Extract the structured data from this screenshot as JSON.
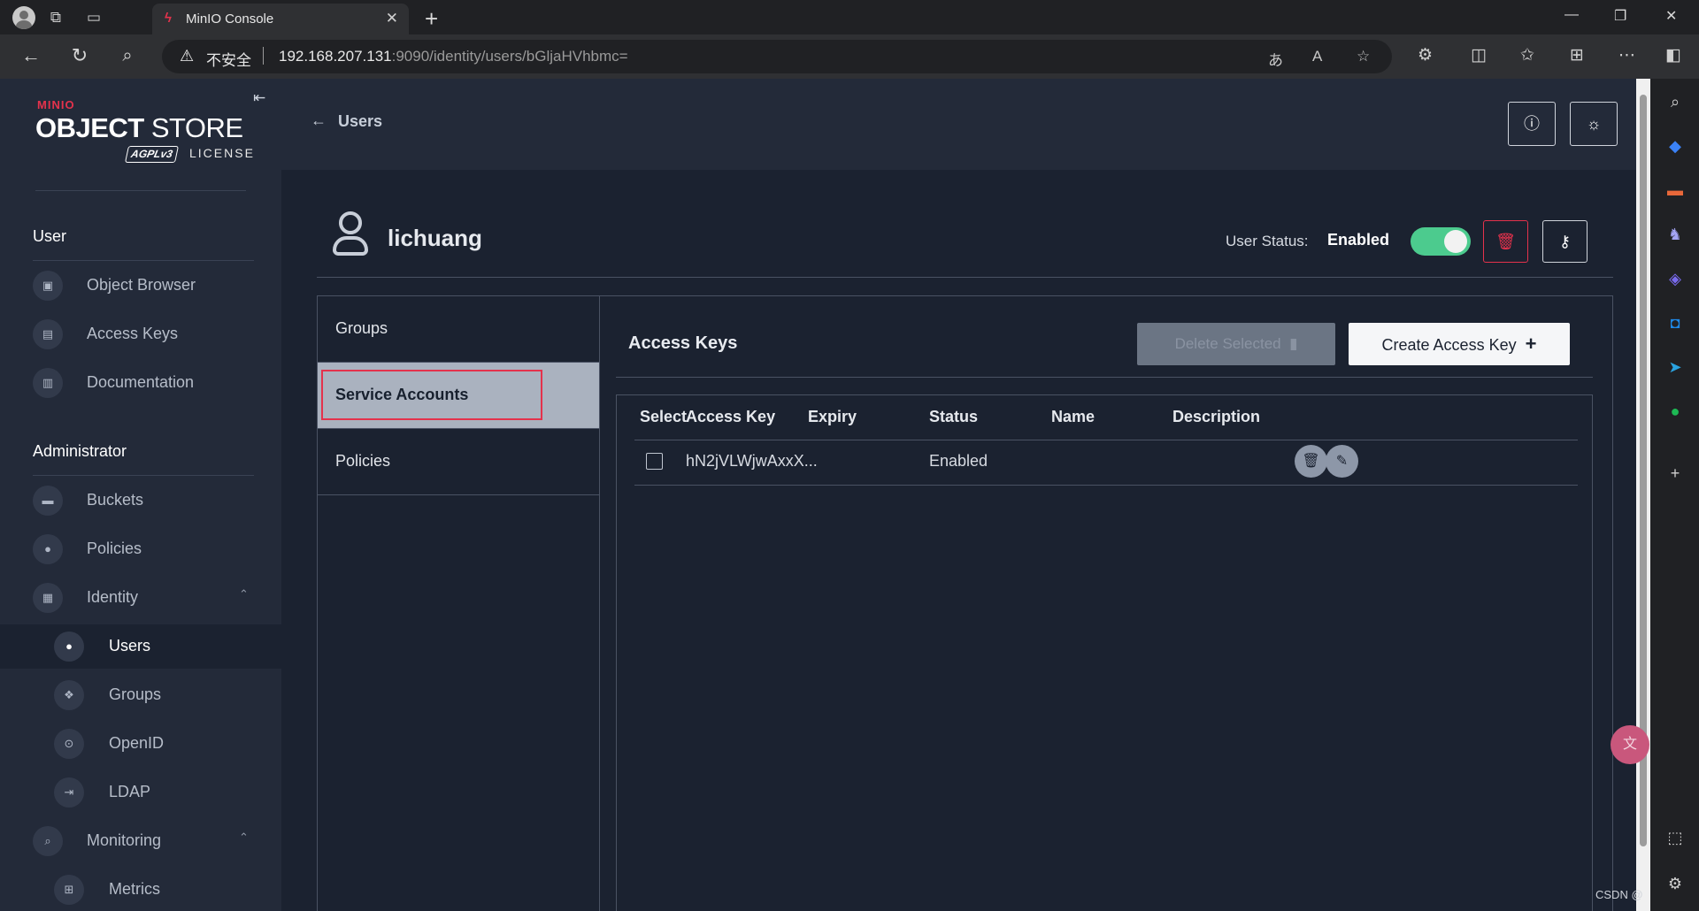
{
  "browser": {
    "tab_title": "MinIO Console",
    "tab_favicon": "minio-favicon",
    "security_warning": "不安全",
    "url_host": "192.168.207.131",
    "url_rest": ":9090/identity/users/bGljaHVhbmc=",
    "icons": [
      "profile-avatar",
      "workspaces-icon",
      "tab-actions-icon",
      "close-icon",
      "new-tab-icon",
      "back-icon",
      "refresh-icon",
      "search-icon",
      "warning-icon",
      "translate-icon",
      "read-aloud-icon",
      "favorite-icon",
      "extensions-icon",
      "split-screen-icon",
      "favorites-icon",
      "collections-icon",
      "more-icon",
      "sidebar-icon"
    ]
  },
  "sidebar": {
    "logo_brand": "MINIO",
    "logo_product_bold": "OBJECT",
    "logo_product_light": " STORE",
    "logo_badge": "AGPLv3",
    "logo_license": "LICENSE",
    "user_section": "User",
    "user_items": [
      {
        "label": "Object Browser",
        "icon": "object-browser-icon"
      },
      {
        "label": "Access Keys",
        "icon": "access-keys-icon"
      },
      {
        "label": "Documentation",
        "icon": "documentation-icon"
      }
    ],
    "admin_section": "Administrator",
    "admin_items": [
      {
        "label": "Buckets",
        "icon": "buckets-icon"
      },
      {
        "label": "Policies",
        "icon": "policies-icon"
      },
      {
        "label": "Identity",
        "icon": "identity-icon"
      },
      {
        "label": "Users",
        "icon": "users-icon"
      },
      {
        "label": "Groups",
        "icon": "groups-icon"
      },
      {
        "label": "OpenID",
        "icon": "openid-icon"
      },
      {
        "label": "LDAP",
        "icon": "ldap-icon"
      },
      {
        "label": "Monitoring",
        "icon": "monitoring-icon"
      },
      {
        "label": "Metrics",
        "icon": "metrics-icon"
      }
    ]
  },
  "header": {
    "breadcrumb": "Users"
  },
  "user": {
    "name": "lichuang",
    "status_label": "User Status:",
    "status_value": "Enabled",
    "status_enabled": true
  },
  "tabs": [
    {
      "label": "Groups"
    },
    {
      "label": "Service Accounts"
    },
    {
      "label": "Policies"
    }
  ],
  "panel": {
    "title": "Access Keys",
    "delete_selected_label": "Delete Selected",
    "create_label": "Create Access Key"
  },
  "table": {
    "columns": [
      "Select",
      "Access Key",
      "Expiry",
      "Status",
      "Name",
      "Description"
    ],
    "rows": [
      {
        "access_key": "hN2jVLWjwAxxX...",
        "expiry": "",
        "status": "Enabled",
        "name": "",
        "description": ""
      }
    ]
  },
  "watermark": "CSDN @"
}
